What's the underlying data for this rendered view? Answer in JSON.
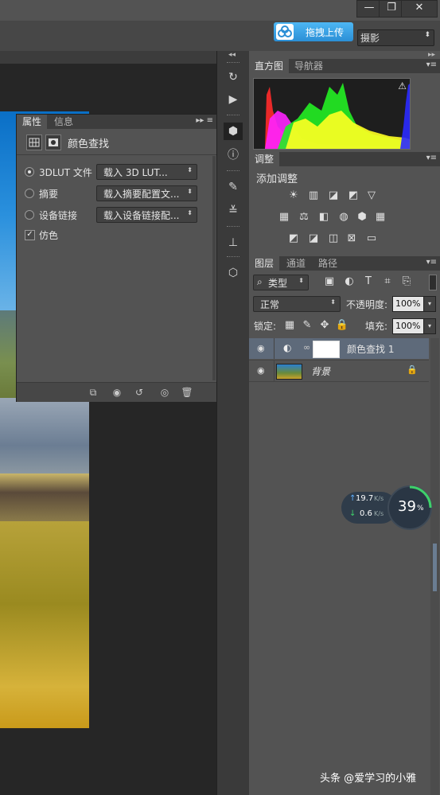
{
  "window": {
    "minimize_label": "—",
    "restore_label": "❐",
    "close_label": "✕"
  },
  "optionbar": {
    "upload_label": "拖拽上传",
    "workspace_value": "摄影",
    "workspace_arrow": "⬍"
  },
  "properties_panel": {
    "tabs": [
      {
        "label": "属性",
        "active": true
      },
      {
        "label": "信息",
        "active": false
      }
    ],
    "menu_glyph": "▸▸ ≡",
    "title": "颜色查找",
    "options": [
      {
        "label": "3DLUT 文件",
        "selected": true,
        "dropdown": "载入 3D LUT..."
      },
      {
        "label": "摘要",
        "selected": false,
        "dropdown": "载入摘要配置文..."
      },
      {
        "label": "设备链接",
        "selected": false,
        "dropdown": "载入设备链接配..."
      }
    ],
    "dither": {
      "label": "仿色",
      "checked": true
    },
    "footer_icons": [
      "clip-icon",
      "visibility-prev-icon",
      "reset-icon",
      "eye-icon",
      "trash-icon"
    ]
  },
  "histogram_panel": {
    "tabs": [
      {
        "label": "直方图",
        "active": true
      },
      {
        "label": "导航器",
        "active": false
      }
    ],
    "warning_glyph": "⚠"
  },
  "adjustments_panel": {
    "tabs": [
      {
        "label": "调整",
        "active": true
      }
    ],
    "heading": "添加调整",
    "row1": [
      "☀",
      "▥",
      "◪",
      "◩",
      "▽"
    ],
    "row2": [
      "▦",
      "⚖",
      "◧",
      "◍",
      "⬢",
      "▦"
    ],
    "row3": [
      "◩",
      "◪",
      "◫",
      "⊠",
      "▭"
    ]
  },
  "layers_panel": {
    "tabs": [
      {
        "label": "图层",
        "active": true
      },
      {
        "label": "通道",
        "active": false
      },
      {
        "label": "路径",
        "active": false
      }
    ],
    "filter_label": "类型",
    "blend_mode": "正常",
    "opacity_label": "不透明度:",
    "opacity_value": "100%",
    "lock_label": "锁定:",
    "fill_label": "填充:",
    "fill_value": "100%",
    "layers": [
      {
        "name": "颜色查找 1",
        "selected": true
      },
      {
        "name": "背景",
        "selected": false
      }
    ]
  },
  "speed_widget": {
    "upload": "19.7",
    "upload_unit": "K/s",
    "download": "0.6",
    "download_unit": "K/s",
    "percent": "39",
    "percent_unit": "%"
  },
  "watermark": "头条 @爱学习的小雅",
  "chart_data": {
    "type": "area",
    "title": "",
    "series": [
      {
        "name": "",
        "color": "#ff2a2a"
      },
      {
        "name": "",
        "color": "#22ee22"
      },
      {
        "name": "",
        "color": "#ffff22"
      },
      {
        "name": "",
        "color": "#ff22ff"
      },
      {
        "name": "",
        "color": "#2a2aff"
      }
    ]
  }
}
